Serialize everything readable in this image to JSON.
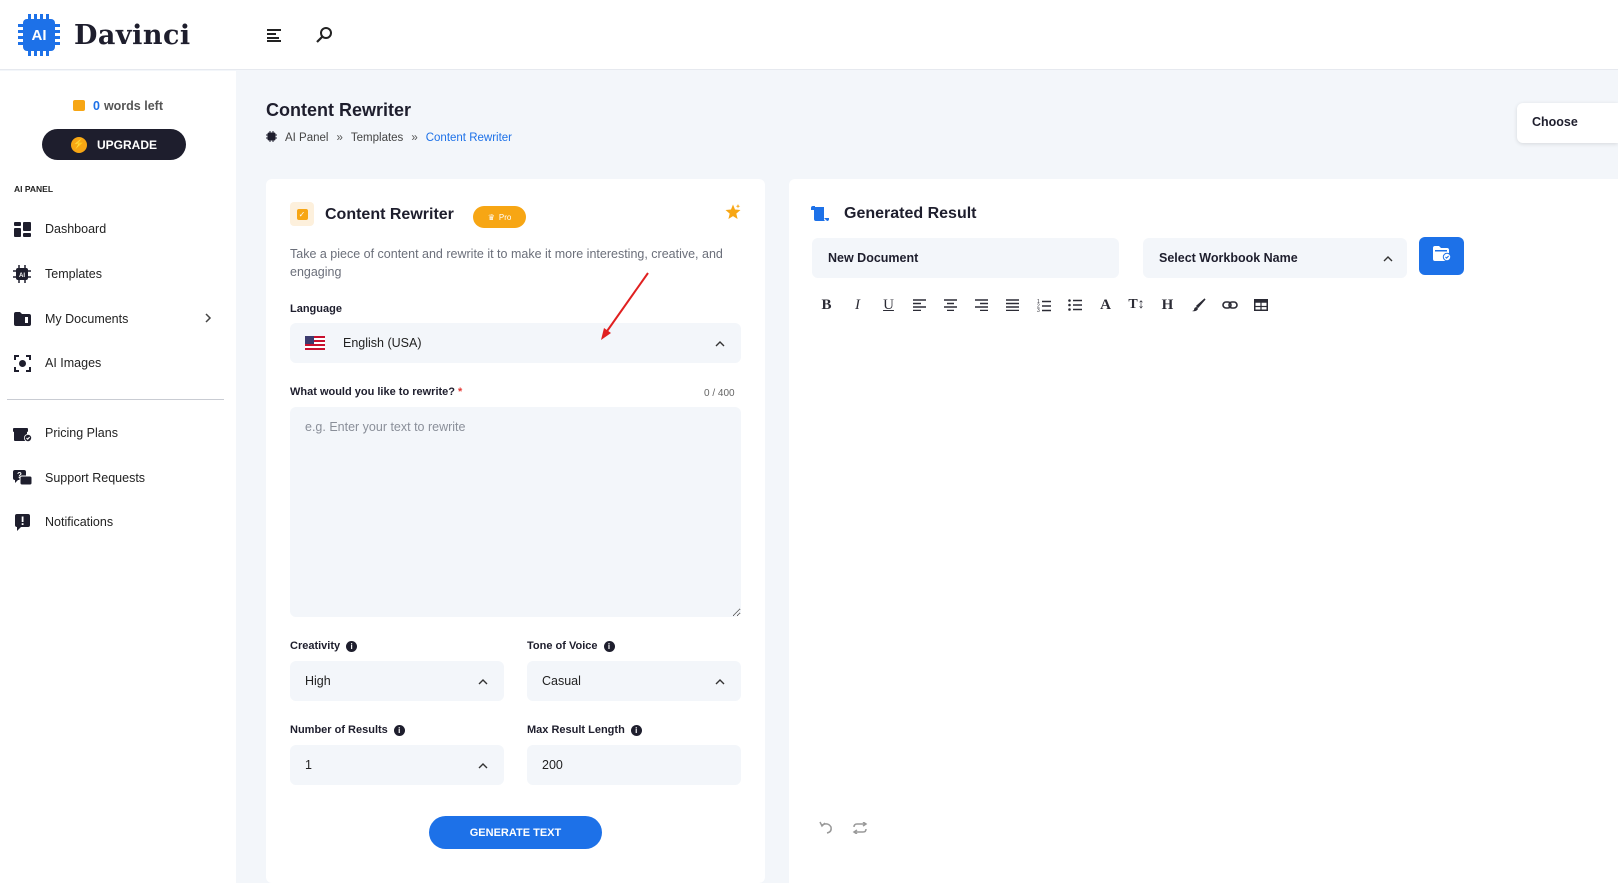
{
  "app": {
    "logo_badge": "AI",
    "logo_text": "Davinci"
  },
  "sidebar": {
    "words_count": "0",
    "words_label": "words left",
    "upgrade_label": "UPGRADE",
    "section_label": "AI PANEL",
    "items": [
      {
        "label": "Dashboard",
        "icon": "dashboard-icon"
      },
      {
        "label": "Templates",
        "icon": "ai-chip-icon"
      },
      {
        "label": "My Documents",
        "icon": "folder-icon"
      },
      {
        "label": "AI Images",
        "icon": "camera-icon"
      },
      {
        "label": "Pricing Plans",
        "icon": "gift-box-icon"
      },
      {
        "label": "Support Requests",
        "icon": "chat-question-icon"
      },
      {
        "label": "Notifications",
        "icon": "alert-message-icon"
      }
    ]
  },
  "page": {
    "title": "Content Rewriter",
    "breadcrumb": [
      "AI Panel",
      "Templates",
      "Content Rewriter"
    ],
    "breadcrumb_sep": "»",
    "choose_label": "Choose"
  },
  "form": {
    "title": "Content Rewriter",
    "badge": "Pro",
    "description": "Take a piece of content and rewrite it to make it more interesting, creative, and engaging",
    "language_label": "Language",
    "language_value": "English (USA)",
    "rewrite_label": "What would you like to rewrite?",
    "required_mark": "*",
    "counter": "0 / 400",
    "rewrite_placeholder": "e.g. Enter your text to rewrite",
    "creativity_label": "Creativity",
    "creativity_value": "High",
    "tone_label": "Tone of Voice",
    "tone_value": "Casual",
    "results_label": "Number of Results",
    "results_value": "1",
    "max_length_label": "Max Result Length",
    "max_length_value": "200",
    "generate_label": "GENERATE TEXT"
  },
  "result": {
    "title": "Generated Result",
    "document_name": "New Document",
    "workbook_placeholder": "Select Workbook Name",
    "toolbar": [
      "bold-icon",
      "italic-icon",
      "underline-icon",
      "align-left-icon",
      "align-center-icon",
      "align-right-icon",
      "align-justify-icon",
      "ordered-list-icon",
      "bullet-list-icon",
      "font-color-icon",
      "text-size-icon",
      "heading-icon",
      "brush-icon",
      "link-icon",
      "table-icon"
    ]
  },
  "colors": {
    "accent": "#1d71e8",
    "pro": "#f7a614",
    "dark": "#1e1e2d",
    "field": "#f3f6fa",
    "arrow": "#e02020"
  }
}
